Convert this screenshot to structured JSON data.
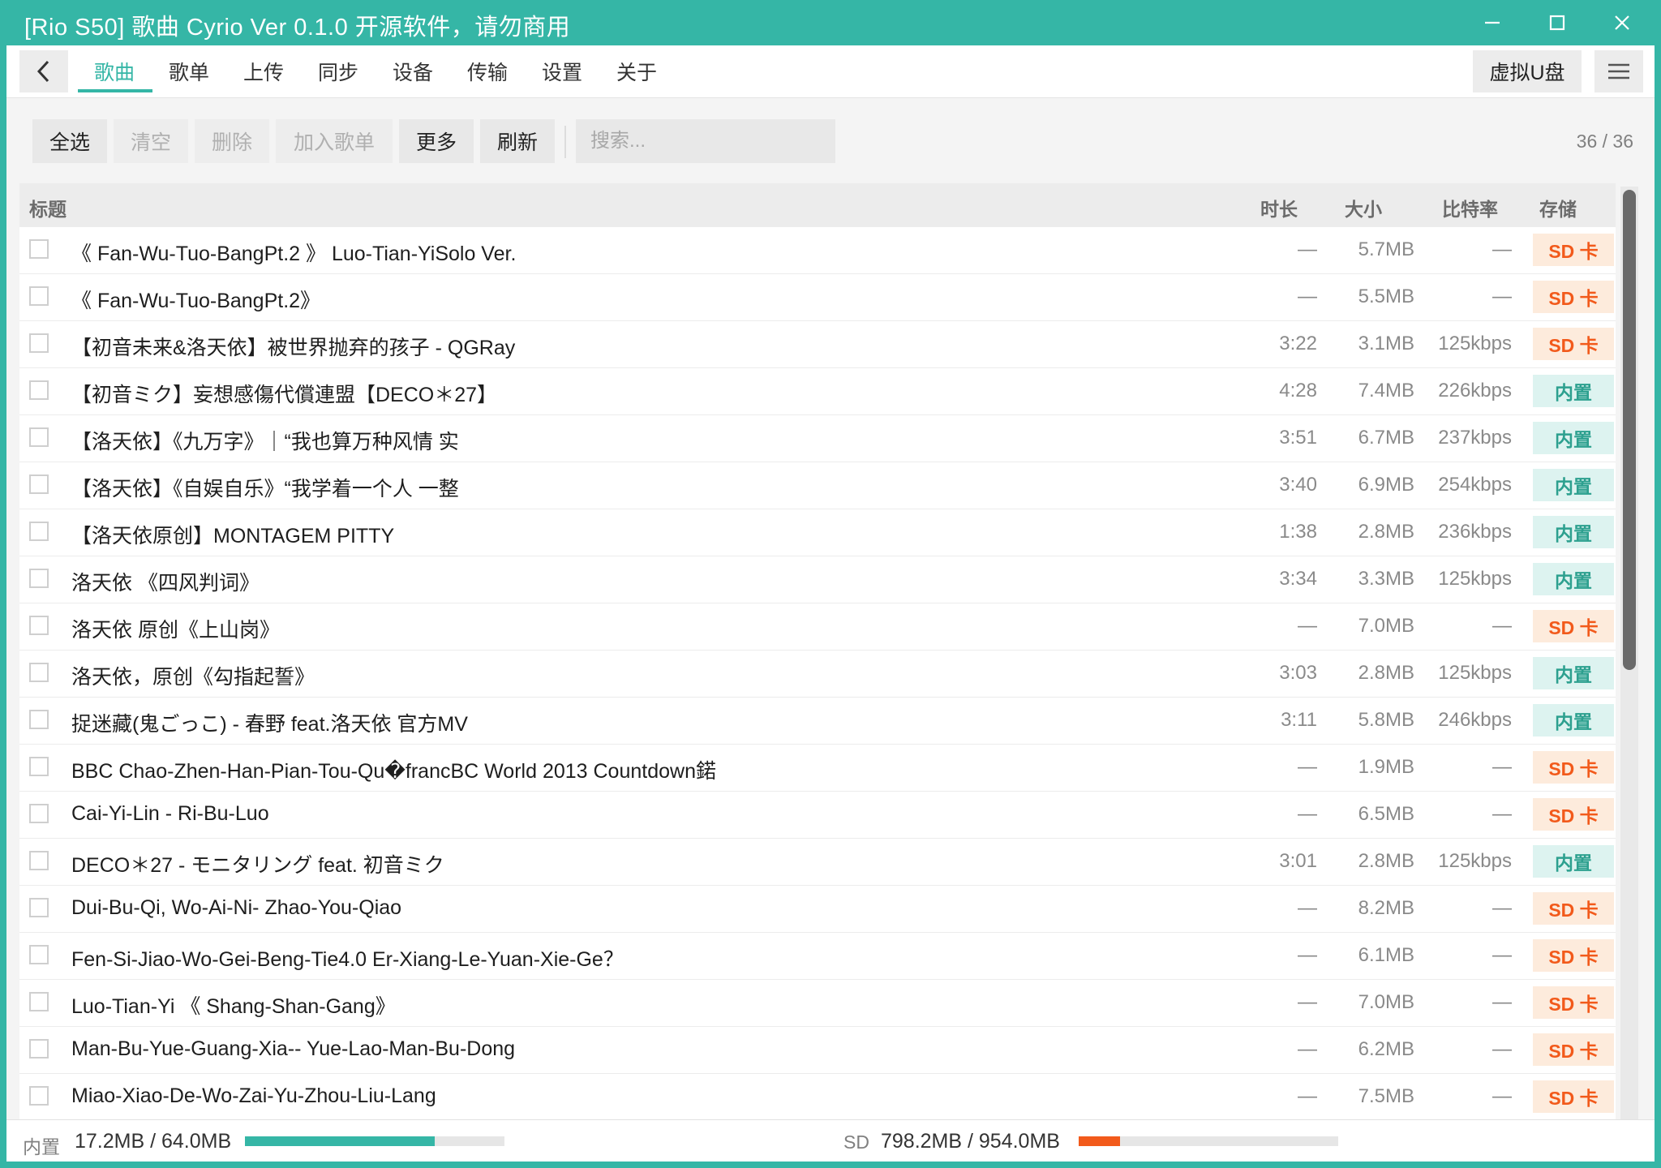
{
  "window": {
    "title": "[Rio S50] 歌曲 Cyrio Ver 0.1.0 开源软件，请勿商用",
    "accent": "#35b6a6",
    "sd_color": "#f25a1b"
  },
  "nav": {
    "tabs": [
      "歌曲",
      "歌单",
      "上传",
      "同步",
      "设备",
      "传输",
      "设置",
      "关于"
    ],
    "active_tab": "歌曲",
    "usb_button": "虚拟U盘"
  },
  "toolbar": {
    "select_all": "全选",
    "clear": "清空",
    "delete": "删除",
    "add_to_playlist": "加入歌单",
    "more": "更多",
    "refresh": "刷新",
    "search_placeholder": "搜索...",
    "count": "36 / 36"
  },
  "table": {
    "headers": {
      "title": "标题",
      "duration": "时长",
      "size": "大小",
      "bitrate": "比特率",
      "storage": "存储"
    },
    "rows": [
      {
        "title": "《 Fan-Wu-Tuo-BangPt.2 》 Luo-Tian-YiSolo Ver.",
        "duration": "—",
        "size": "5.7MB",
        "bitrate": "—",
        "storage": "SD 卡"
      },
      {
        "title": "《 Fan-Wu-Tuo-BangPt.2》",
        "duration": "—",
        "size": "5.5MB",
        "bitrate": "—",
        "storage": "SD 卡"
      },
      {
        "title": "【初音未来&洛天依】被世界抛弃的孩子 - QGRay",
        "duration": "3:22",
        "size": "3.1MB",
        "bitrate": "125kbps",
        "storage": "SD 卡"
      },
      {
        "title": "【初音ミク】妄想感傷代償連盟【DECO＊27】",
        "duration": "4:28",
        "size": "7.4MB",
        "bitrate": "226kbps",
        "storage": "内置"
      },
      {
        "title": "【洛天依】《九万字》｜“我也算万种风情 实",
        "duration": "3:51",
        "size": "6.7MB",
        "bitrate": "237kbps",
        "storage": "内置"
      },
      {
        "title": "【洛天依】《自娱自乐》“我学着一个人 一整",
        "duration": "3:40",
        "size": "6.9MB",
        "bitrate": "254kbps",
        "storage": "内置"
      },
      {
        "title": "【洛天依原创】MONTAGEM PITTY",
        "duration": "1:38",
        "size": "2.8MB",
        "bitrate": "236kbps",
        "storage": "内置"
      },
      {
        "title": "洛天依 《四风判词》",
        "duration": "3:34",
        "size": "3.3MB",
        "bitrate": "125kbps",
        "storage": "内置"
      },
      {
        "title": "洛天依 原创《上山岗》",
        "duration": "—",
        "size": "7.0MB",
        "bitrate": "—",
        "storage": "SD 卡"
      },
      {
        "title": "洛天依，原创《勾指起誓》",
        "duration": "3:03",
        "size": "2.8MB",
        "bitrate": "125kbps",
        "storage": "内置"
      },
      {
        "title": "捉迷藏(鬼ごっこ) - 春野 feat.洛天依 官方MV",
        "duration": "3:11",
        "size": "5.8MB",
        "bitrate": "246kbps",
        "storage": "内置"
      },
      {
        "title": "BBC Chao-Zhen-Han-Pian-Tou-Qu�francBC World 2013 Countdown鍩",
        "duration": "—",
        "size": "1.9MB",
        "bitrate": "—",
        "storage": "SD 卡"
      },
      {
        "title": "Cai-Yi-Lin - Ri-Bu-Luo",
        "duration": "—",
        "size": "6.5MB",
        "bitrate": "—",
        "storage": "SD 卡"
      },
      {
        "title": "DECO＊27 - モニタリング feat. 初音ミク",
        "duration": "3:01",
        "size": "2.8MB",
        "bitrate": "125kbps",
        "storage": "内置"
      },
      {
        "title": "Dui-Bu-Qi, Wo-Ai-Ni- Zhao-You-Qiao",
        "duration": "—",
        "size": "8.2MB",
        "bitrate": "—",
        "storage": "SD 卡"
      },
      {
        "title": "Fen-Si-Jiao-Wo-Gei-Beng-Tie4.0 Er-Xiang-Le-Yuan-Xie-Ge？",
        "duration": "—",
        "size": "6.1MB",
        "bitrate": "—",
        "storage": "SD 卡"
      },
      {
        "title": "Luo-Tian-Yi 《 Shang-Shan-Gang》",
        "duration": "—",
        "size": "7.0MB",
        "bitrate": "—",
        "storage": "SD 卡"
      },
      {
        "title": "Man-Bu-Yue-Guang-Xia-- Yue-Lao-Man-Bu-Dong",
        "duration": "—",
        "size": "6.2MB",
        "bitrate": "—",
        "storage": "SD 卡"
      },
      {
        "title": "Miao-Xiao-De-Wo-Zai-Yu-Zhou-Liu-Lang",
        "duration": "—",
        "size": "7.5MB",
        "bitrate": "—",
        "storage": "SD 卡"
      }
    ]
  },
  "status": {
    "internal_label": "内置",
    "internal_value": "17.2MB / 64.0MB",
    "internal_fill": 0.73,
    "sd_label": "SD",
    "sd_value": "798.2MB / 954.0MB",
    "sd_fill": 0.16
  }
}
